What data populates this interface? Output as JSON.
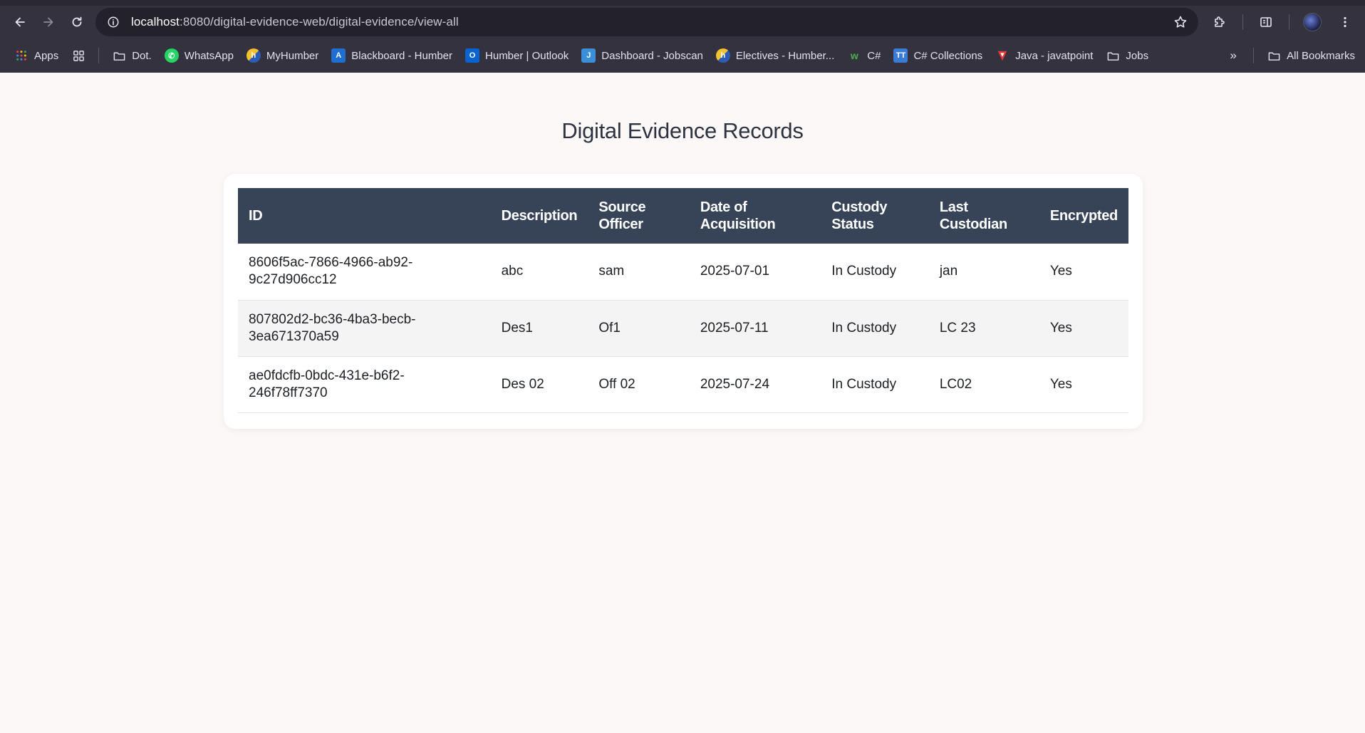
{
  "browser": {
    "url_host": "localhost",
    "url_path": ":8080/digital-evidence-web/digital-evidence/view-all",
    "bookmarks": [
      {
        "label": "Apps",
        "icon": "apps-grid-icon"
      },
      {
        "label": "Dot.",
        "icon": "folder-icon"
      },
      {
        "label": "WhatsApp",
        "icon": "whatsapp-icon",
        "color": "#25d366"
      },
      {
        "label": "MyHumber",
        "icon": "humber-icon",
        "color": "#f2c230"
      },
      {
        "label": "Blackboard - Humber",
        "icon": "blackboard-icon",
        "color": "#1f6fd1"
      },
      {
        "label": "Humber | Outlook",
        "icon": "outlook-icon",
        "color": "#0a64d0"
      },
      {
        "label": "Dashboard - Jobscan",
        "icon": "jobscan-icon",
        "color": "#3b8fd9"
      },
      {
        "label": "Electives - Humber...",
        "icon": "humber-icon",
        "color": "#f2c230"
      },
      {
        "label": "C#",
        "icon": "w3-icon",
        "color": "#4caf50"
      },
      {
        "label": "C# Collections",
        "icon": "tutorialsteacher-icon",
        "color": "#3a7bd5"
      },
      {
        "label": "Java - javatpoint",
        "icon": "javatpoint-icon",
        "color": "#e53935"
      },
      {
        "label": "Jobs",
        "icon": "folder-icon"
      }
    ],
    "all_bookmarks": "All Bookmarks"
  },
  "page": {
    "title": "Digital Evidence Records"
  },
  "table": {
    "headers": {
      "id": "ID",
      "description": "Description",
      "source_officer": "Source Officer",
      "date": "Date of Acquisition",
      "status": "Custody Status",
      "last_custodian": "Last Custodian",
      "encrypted": "Encrypted"
    },
    "rows": [
      {
        "id": "8606f5ac-7866-4966-ab92-9c27d906cc12",
        "description": "abc",
        "source_officer": "sam",
        "date": "2025-07-01",
        "status": "In Custody",
        "last_custodian": "jan",
        "encrypted": "Yes"
      },
      {
        "id": "807802d2-bc36-4ba3-becb-3ea671370a59",
        "description": "Des1",
        "source_officer": "Of1",
        "date": "2025-07-11",
        "status": "In Custody",
        "last_custodian": "LC 23",
        "encrypted": "Yes"
      },
      {
        "id": "ae0fdcfb-0bdc-431e-b6f2-246f78ff7370",
        "description": "Des 02",
        "source_officer": "Off 02",
        "date": "2025-07-24",
        "status": "In Custody",
        "last_custodian": "LC02",
        "encrypted": "Yes"
      }
    ]
  }
}
